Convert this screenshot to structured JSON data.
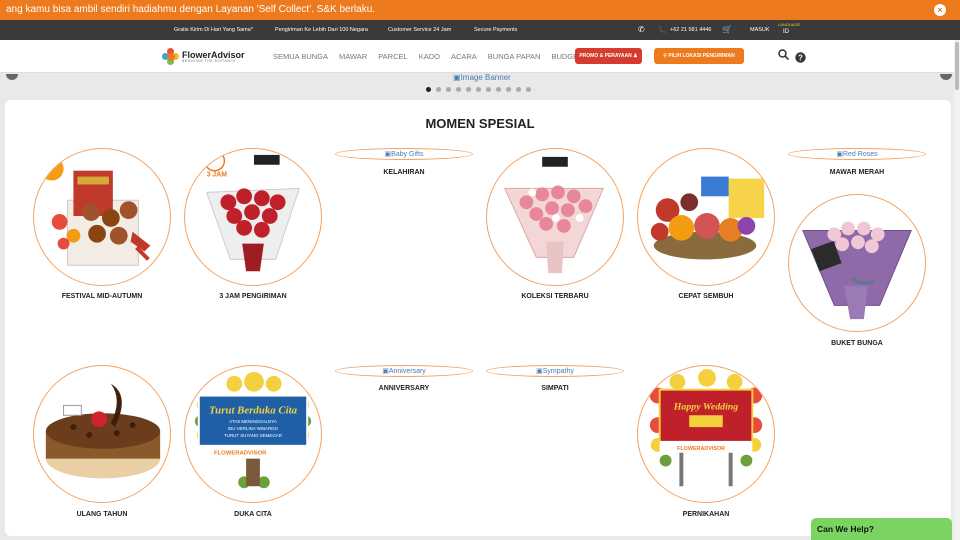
{
  "promo": {
    "text": "ang kamu bisa ambil sendiri hadiahmu dengan Layanan 'Self Collect'. S&K berlaku.",
    "close": "×"
  },
  "infobar": {
    "items": [
      "Gratis Kirim Di Hari Yang Sama*",
      "Pengiriman Ke Lebih Dari 100 Negara",
      "Customer Service 24 Jam",
      "Secure Payments"
    ],
    "phone": "+62 21 581 4446",
    "login": "MASUK",
    "language_label": "LANGUAGE",
    "language_value": "ID"
  },
  "header": {
    "logo_name": "FlowerAdvisor",
    "logo_tagline": "BRIDGING THE DISTANCE",
    "nav": [
      "SEMUA BUNGA",
      "MAWAR",
      "PARCEL",
      "KADO",
      "ACARA",
      "BUNGA PAPAN",
      "BUDGET"
    ],
    "promo_button": "PROMO & PERAYAAN",
    "location_button": "PILIH LOKASI PENGIRIMAN"
  },
  "banner": {
    "alt": "Image Banner",
    "dot_count": 11,
    "active_dot": 0
  },
  "section": {
    "title": "MOMEN SPESIAL"
  },
  "items": [
    {
      "label": "FESTIVAL MID-AUTUMN",
      "image": "mooncake-hamper"
    },
    {
      "label": "3 JAM PENGIRIMAN",
      "image": "red-rose-bouquet",
      "badge": "3 JAM"
    },
    {
      "label": "KELAHIRAN",
      "alt": "Baby Gifts",
      "broken": true
    },
    {
      "label": "KOLEKSI TERBARU",
      "image": "pink-bouquet"
    },
    {
      "label": "CEPAT SEMBUH",
      "image": "fruit-basket"
    },
    {
      "label": "MAWAR MERAH",
      "alt": "Red Roses",
      "broken": true
    },
    {
      "label": "BUKET BUNGA",
      "image": "purple-bouquet"
    },
    {
      "label": "ULANG TAHUN",
      "image": "chocolate-cake"
    },
    {
      "label": "DUKA CITA",
      "image": "condolence-board"
    },
    {
      "label": "ANNIVERSARY",
      "alt": "Anniversary",
      "broken": true
    },
    {
      "label": "SIMPATI",
      "alt": "Sympathy",
      "broken": true
    },
    {
      "label": "PERNIKAHAN",
      "image": "wedding-board"
    }
  ],
  "boards": {
    "duka_title": "Turut Berduka Cita",
    "duka_lines": [
      "ATAS MENINGGALNYA",
      "IBU HERLINA WIBARDO",
      "TURUT SUYANG SEMEGAR"
    ],
    "wedding_title": "Happy Wedding",
    "brand": "FLOWERADVISOR"
  },
  "help": {
    "text": "Can We Help?"
  },
  "colors": {
    "orange": "#ed7a1c",
    "red": "#d63b2f",
    "green": "#7bd461",
    "ring": "#f4a261"
  }
}
